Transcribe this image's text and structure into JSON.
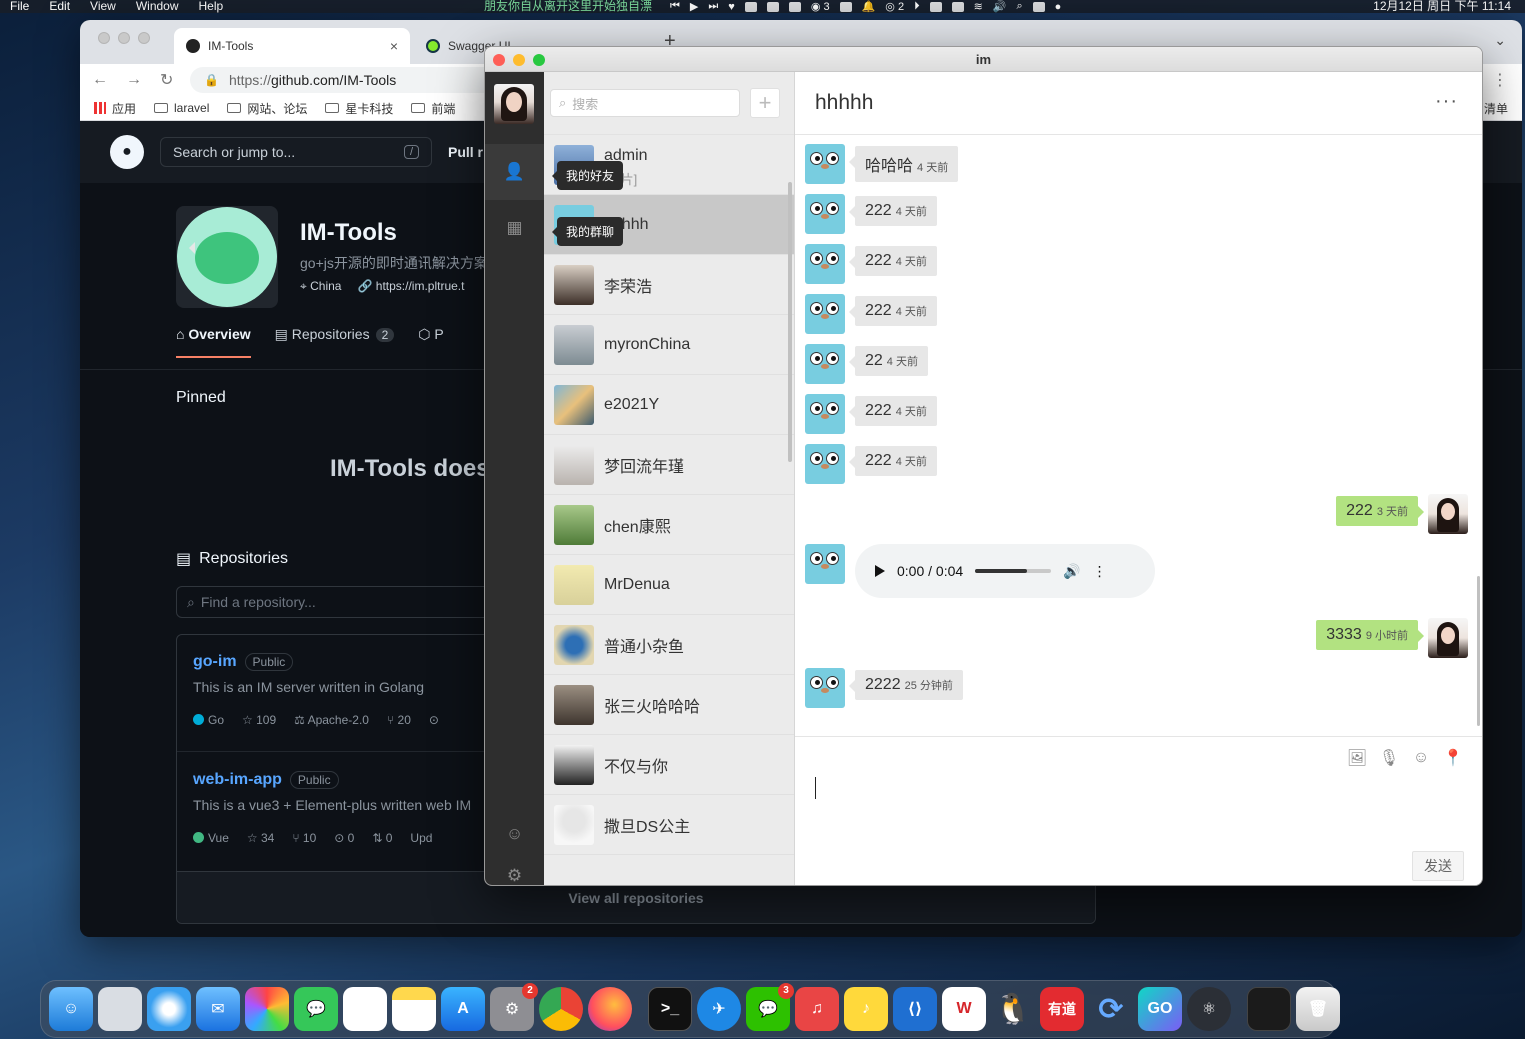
{
  "menubar": {
    "items": [
      "File",
      "Edit",
      "View",
      "Window",
      "Help"
    ],
    "ticker": "朋友你自从离开这里开始独自漂",
    "badges": [
      "3",
      "2"
    ],
    "clock": "12月12日 周日 下午 11:14"
  },
  "browser": {
    "tabs": [
      {
        "label": "IM-Tools"
      },
      {
        "label": "Swagger UI"
      }
    ],
    "url_scheme": "https://",
    "url_host": "github.com/IM-Tools",
    "bookmarks": [
      "应用",
      "laravel",
      "网站、论坛",
      "星卡科技",
      "前端"
    ],
    "right_partial": "清单"
  },
  "github": {
    "search_placeholder": "Search or jump to...",
    "search_key": "/",
    "nav_partial": "Pull r",
    "org_name": "IM-Tools",
    "org_desc": "go+js开源的即时通讯解决方案",
    "location": "China",
    "website": "https://im.pltrue.t",
    "tabs": [
      {
        "label": "Overview"
      },
      {
        "label": "Repositories",
        "count": "2"
      },
      {
        "label": "P"
      }
    ],
    "pinned": "Pinned",
    "hero": "IM-Tools does",
    "repos_heading": "Repositories",
    "find_placeholder": "Find a repository...",
    "repos": [
      {
        "name": "go-im",
        "visibility": "Public",
        "desc": "This is an IM server written in Golang",
        "lang": "Go",
        "lang_color": "#00add8",
        "stars": "109",
        "license": "Apache-2.0",
        "forks": "20"
      },
      {
        "name": "web-im-app",
        "visibility": "Public",
        "desc": "This is a vue3 + Element-plus written web IM",
        "lang": "Vue",
        "lang_color": "#41b883",
        "stars": "34",
        "forks": "10",
        "issues": "0",
        "prs": "0",
        "updated": "Upd"
      }
    ],
    "view_all": "View all repositories"
  },
  "im": {
    "title": "im",
    "tooltips": {
      "friends": "我的好友",
      "groups": "我的群聊"
    },
    "search_placeholder": "搜索",
    "add_label": "+",
    "contacts": [
      {
        "name": "admin",
        "sub": "[图片]"
      },
      {
        "name": "hhhhh"
      },
      {
        "name": "李荣浩"
      },
      {
        "name": "myronChina"
      },
      {
        "name": "e2021Y"
      },
      {
        "name": "梦回流年瑾"
      },
      {
        "name": "chen康熙"
      },
      {
        "name": "MrDenua"
      },
      {
        "name": "普通小杂鱼"
      },
      {
        "name": "张三火哈哈哈"
      },
      {
        "name": "不仅与你"
      },
      {
        "name": "撒旦DS公主"
      }
    ],
    "chat_title": "hhhhh",
    "more_label": "···",
    "messages": [
      {
        "text": "哈哈哈",
        "time": "4 天前",
        "mine": false
      },
      {
        "text": "222",
        "time": "4 天前",
        "mine": false
      },
      {
        "text": "222",
        "time": "4 天前",
        "mine": false
      },
      {
        "text": "222",
        "time": "4 天前",
        "mine": false
      },
      {
        "text": "22",
        "time": "4 天前",
        "mine": false
      },
      {
        "text": "222",
        "time": "4 天前",
        "mine": false
      },
      {
        "text": "222",
        "time": "4 天前",
        "mine": false
      },
      {
        "text": "222",
        "time": "3 天前",
        "mine": true
      },
      {
        "text": "3333",
        "time": "9 小时前",
        "mine": true
      },
      {
        "text": "2222",
        "time": "25 分钟前",
        "mine": false
      }
    ],
    "audio": {
      "current": "0:00",
      "sep": "/",
      "duration": "0:04",
      "progress": 0.68
    },
    "send_label": "发送"
  },
  "dock": {
    "badges": {
      "settings": "2",
      "wechat": "3"
    },
    "youdao_label": "有道",
    "goland_label": "GO"
  }
}
